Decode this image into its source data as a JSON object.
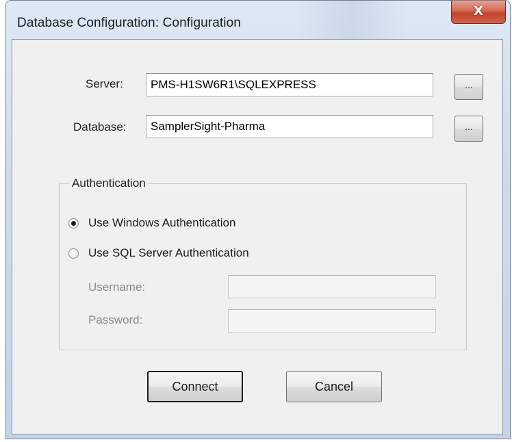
{
  "window": {
    "title": "Database Configuration: Configuration",
    "close_label": "X"
  },
  "form": {
    "server_label": "Server:",
    "server_value": "PMS-H1SW6R1\\SQLEXPRESS",
    "server_browse_label": "...",
    "database_label": "Database:",
    "database_value": "SamplerSight-Pharma",
    "database_browse_label": "..."
  },
  "authentication": {
    "group_label": "Authentication",
    "windows_auth_label": "Use Windows Authentication",
    "windows_auth_selected": true,
    "sql_auth_label": "Use SQL Server Authentication",
    "sql_auth_selected": false,
    "username_label": "Username:",
    "username_value": "",
    "password_label": "Password:",
    "password_value": ""
  },
  "actions": {
    "connect_label": "Connect",
    "cancel_label": "Cancel"
  }
}
